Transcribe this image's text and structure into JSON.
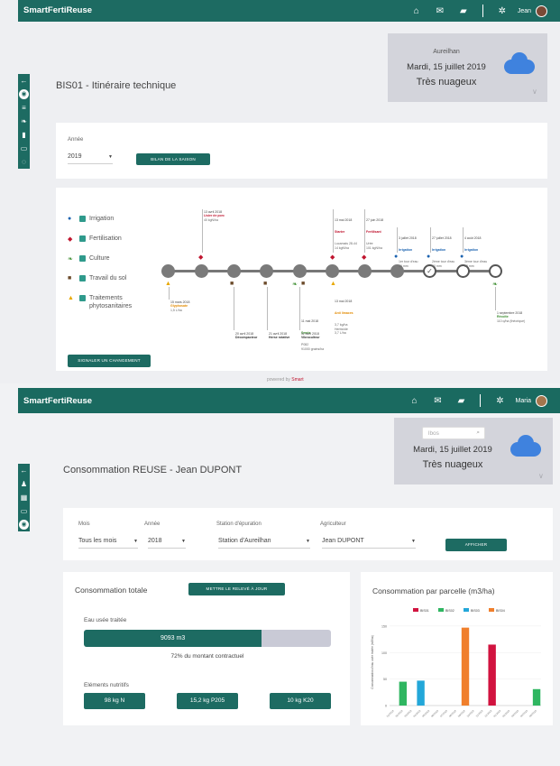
{
  "colors": {
    "primary": "#1d6b62",
    "cloud": "#3f82de",
    "red": "#c0152f",
    "blue": "#1c63b0",
    "orange": "#e28a00",
    "green": "#3b8c2e"
  },
  "screen1": {
    "brand": "SmartFertiReuse",
    "user_name": "Jean",
    "nav_icons": [
      "home-icon",
      "mail-icon",
      "chat-icon",
      "gear-icon"
    ],
    "sidebar_icons": [
      "arrow-left-icon",
      "location-icon",
      "sliders-icon",
      "leaf-icon",
      "chart-icon",
      "calendar-icon",
      "reuse-icon"
    ],
    "page_title": "BIS01 - Itinéraire technique",
    "weather": {
      "place": "Aureilhan",
      "date": "Mardi, 15 juillet 2019",
      "condition": "Très nuageux"
    },
    "year_label": "Année",
    "year_value": "2019",
    "season_button": "BILAN DE LA SAISON",
    "legend": [
      {
        "icon": "drop-icon",
        "label": "Irrigation",
        "color": "#1c63b0"
      },
      {
        "icon": "fertilizer-icon",
        "label": "Fertilisation",
        "color": "#c0152f"
      },
      {
        "icon": "leaf-icon",
        "label": "Culture",
        "color": "#3b8c2e"
      },
      {
        "icon": "tractor-icon",
        "label": "Travail du sol",
        "color": "#6b4a2a"
      },
      {
        "icon": "spray-icon",
        "label": "Traitements phytosanitaires",
        "color": "#e8a800"
      }
    ],
    "events": [
      {
        "date": "15 mars 2018",
        "title": "Glyphosate",
        "detail": "1,5 L/ha",
        "kind": "ora"
      },
      {
        "date": "13 avril 2018",
        "title": "Lisier de porc",
        "detail": "40 kgN/ha",
        "kind": "red"
      },
      {
        "date": "20 avril 2018",
        "title": "Décompacteur",
        "detail": "",
        "kind": "blk"
      },
      {
        "date": "21 avril 2018",
        "title": "Herse rotative",
        "detail": "",
        "kind": "blk"
      },
      {
        "date": "11 mai 2018",
        "title": "Semis",
        "detail": "P082\n91000 grains/ha",
        "kind": "grn"
      },
      {
        "date": "11 avril 2018",
        "title": "Vibroculteur",
        "detail": "",
        "kind": "blk"
      },
      {
        "date": "13 mai 2018",
        "title": "Starter",
        "detail": "Lucamais 28-44\n14 kgN/ha",
        "kind": "red"
      },
      {
        "date": "13 mai 2018",
        "title": "Anti limaces",
        "detail": "3,7 kg/ha\nHerbicide\n3,7 L/ha",
        "kind": "ora"
      },
      {
        "date": "27 juin 2018",
        "title": "Fertilisant",
        "detail": "Urée\n101 kgN/ha",
        "kind": "red"
      },
      {
        "date": "3 juillet 2018",
        "title": "Irrigation",
        "detail": "1er tour d'eau\n30 mm",
        "kind": "blue"
      },
      {
        "date": "27 juillet 2018",
        "title": "Irrigation",
        "detail": "2ème tour d'eau\n40 mm",
        "kind": "blue"
      },
      {
        "date": "4 août 2018",
        "title": "Irrigation",
        "detail": "3ème tour d'eau\n35 mm",
        "kind": "blue"
      },
      {
        "date": "1 septembre 2018",
        "title": "Récolte",
        "detail": "110 q/ha (théorique)",
        "kind": "grn"
      }
    ],
    "report_button": "SIGNALER UN CHANGEMENT",
    "footer_prefix": "powered by",
    "footer_brand": "Smart"
  },
  "screen2": {
    "brand": "SmartFertiReuse",
    "user_name": "Maria",
    "nav_icons": [
      "home-icon",
      "alert-mail-icon",
      "chat-icon",
      "gear-icon"
    ],
    "sidebar_icons": [
      "arrow-left-icon",
      "users-icon",
      "grid-icon",
      "calendar-icon",
      "reuse-icon"
    ],
    "search_value": "lbos",
    "weather": {
      "date": "Mardi, 15 juillet 2019",
      "condition": "Très nuageux"
    },
    "page_title": "Consommation REUSE - Jean DUPONT",
    "filters": [
      {
        "label": "Mois",
        "value": "Tous les mois"
      },
      {
        "label": "Année",
        "value": "2018"
      },
      {
        "label": "Station d'épuration",
        "value": "Station d'Aureilhan"
      },
      {
        "label": "Agriculteur",
        "value": "Jean DUPONT"
      }
    ],
    "show_button": "AFFICHER",
    "total_title": "Consommation totale",
    "update_button": "METTRE LE RELEVÉ À JOUR",
    "treated_water_label": "Eau usée traitée",
    "treated_water_value": "9093 m3",
    "contract_share": 0.72,
    "contract_text": "72% du montant contractuel",
    "nutrients_label": "Eléments nutritifs",
    "nutrients": [
      "98 kg N",
      "15,2 kg P205",
      "10 kg K20"
    ]
  },
  "chart_data": {
    "type": "bar",
    "title": "Consommation par parcelle (m3/ha)",
    "ylabel": "Consommation d'eau usée traitée (m3/ha)",
    "ylim": [
      0,
      160
    ],
    "yticks": [
      0,
      50,
      100,
      150
    ],
    "xticks": [
      "01/2018",
      "02/2018",
      "03/2018",
      "04/2018",
      "05/2018",
      "06/2018",
      "07/2018",
      "08/2018",
      "09/2018",
      "10/2018",
      "11/2018",
      "12/2018",
      "01/2019",
      "02/2019",
      "03/2019",
      "04/2019",
      "05/2019"
    ],
    "series": [
      {
        "name": "BIS01",
        "color": "#d1133f",
        "values": [
          null,
          null,
          null,
          null,
          null,
          null,
          null,
          null,
          null,
          null,
          null,
          115,
          null,
          null,
          null,
          null,
          null
        ]
      },
      {
        "name": "BIS02",
        "color": "#2fb661",
        "values": [
          null,
          45,
          null,
          null,
          null,
          null,
          null,
          null,
          null,
          null,
          null,
          null,
          null,
          null,
          null,
          null,
          31
        ]
      },
      {
        "name": "BIS03",
        "color": "#23a7d9",
        "values": [
          null,
          null,
          null,
          47,
          null,
          null,
          null,
          null,
          null,
          null,
          null,
          null,
          null,
          null,
          null,
          null,
          null
        ]
      },
      {
        "name": "BIS04",
        "color": "#f07f2c",
        "values": [
          null,
          null,
          null,
          null,
          null,
          null,
          null,
          null,
          147,
          null,
          null,
          null,
          null,
          null,
          null,
          null,
          null
        ]
      }
    ]
  }
}
